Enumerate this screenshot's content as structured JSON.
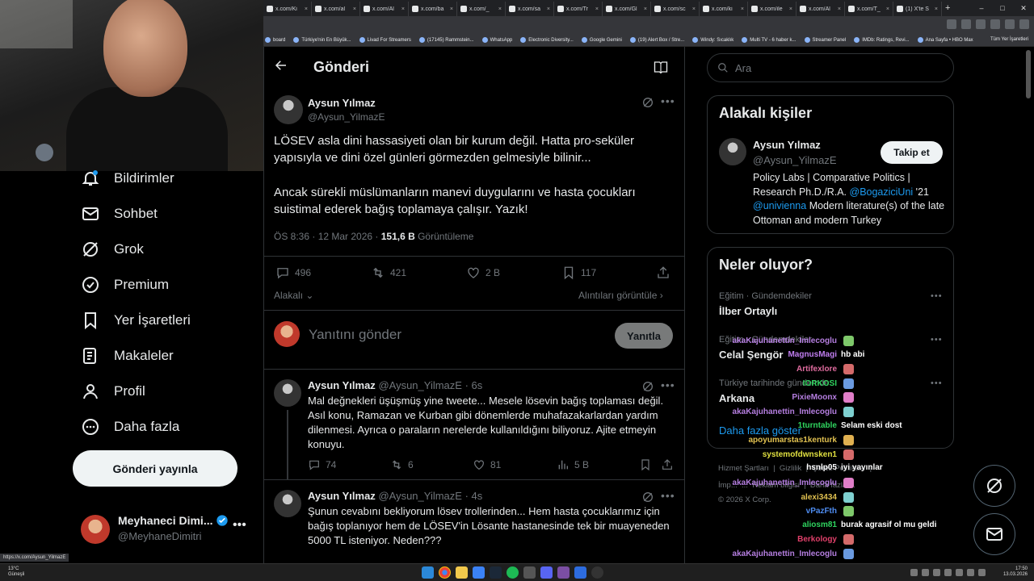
{
  "browser": {
    "tabs": [
      "x.com/Ki",
      "x.com/al",
      "x.com/Al",
      "x.com/ba",
      "x.com/_",
      "x.com/sa",
      "x.com/Tr",
      "x.com/Gl",
      "x.com/sc",
      "x.com/ki",
      "x.com/ile",
      "x.com/Al",
      "x.com/T_",
      "(1) X'te S"
    ],
    "bookmarks": [
      "board",
      "Türkiye'nin En Büyük...",
      "Livad For Streamers",
      "(17145) Rammstein...",
      "WhatsApp",
      "Electronic Diversity...",
      "Google Gemini",
      "(19) Alert Box / Stre...",
      "Windy: Sıcaklık",
      "Multi TV - 6 haber k...",
      "Streamer Panel",
      "IMDb: Ratings, Revi...",
      "Ana Sayfa • HBO Max"
    ],
    "bookmarks_all": "Tüm Yer İşaretleri",
    "status_url": "https://x.com/Aysun_YilmazE"
  },
  "nav": {
    "items": [
      {
        "label": "Bildirimler",
        "icon": "bell-icon"
      },
      {
        "label": "Sohbet",
        "icon": "mail-icon"
      },
      {
        "label": "Grok",
        "icon": "grok-icon"
      },
      {
        "label": "Premium",
        "icon": "verified-icon"
      },
      {
        "label": "Yer İşaretleri",
        "icon": "bookmark-icon"
      },
      {
        "label": "Makaleler",
        "icon": "article-icon"
      },
      {
        "label": "Profil",
        "icon": "person-icon"
      },
      {
        "label": "Daha fazla",
        "icon": "more-circle-icon"
      }
    ],
    "post_button": "Gönderi yayınla",
    "account": {
      "name": "Meyhaneci Dimi...",
      "handle": "@MeyhaneDimitri"
    }
  },
  "post": {
    "header_title": "Gönderi",
    "author_name": "Aysun Yılmaz",
    "author_handle": "@Aysun_YilmazE",
    "paragraph1": "LÖSEV asla dini hassasiyeti olan bir kurum değil. Hatta pro-seküler yapısıyla ve dini özel günleri görmezden gelmesiyle bilinir...",
    "paragraph2": "Ancak sürekli müslümanların manevi duygularını ve hasta çocukları suistimal ederek bağış toplamaya çalışır. Yazık!",
    "time": "ÖS 8:36 · 12 Mar 2026 · ",
    "views": "151,6 B",
    "views_label": " Görüntüleme",
    "stats": {
      "replies": "496",
      "reposts": "421",
      "likes": "2 B",
      "bookmarks": "117"
    },
    "relevance": "Alakalı",
    "quotes_link": "Alıntıları görüntüle",
    "reply_placeholder": "Yanıtını gönder",
    "reply_button": "Yanıtla"
  },
  "replies": [
    {
      "name": "Aysun Yılmaz",
      "handle": "@Aysun_YilmazE · 6s",
      "text": "Mal değnekleri üşüşmüş yine tweete... Mesele lösevin bağış toplaması değil. Asıl konu, Ramazan ve Kurban gibi dönemlerde muhafazakarlardan yardım dilenmesi. Ayrıca o paraların nerelerde kullanıldığını biliyoruz. Ajite etmeyin konuyu.",
      "replies": "74",
      "reposts": "6",
      "likes": "81",
      "views": "5 B"
    },
    {
      "name": "Aysun Yılmaz",
      "handle": "@Aysun_YilmazE · 4s",
      "text": "Şunun cevabını bekliyorum lösev trollerinden... Hem hasta çocuklarımız için bağış toplanıyor hem de LÖSEV'in Lösante hastanesinde tek bir muayeneden 5000 TL isteniyor. Neden???"
    }
  ],
  "right": {
    "search_placeholder": "Ara",
    "related_title": "Alakalı kişiler",
    "related": {
      "name": "Aysun Yılmaz",
      "handle": "@Aysun_YilmazE",
      "follow": "Takip et",
      "bio_1": "Policy Labs | Comparative Politics | Research Ph.D./R.A. ",
      "bio_mention1": "@BogaziciUni",
      "bio_2": " '21 ",
      "bio_mention2": "@univienna",
      "bio_3": " Modern literature(s) of the late Ottoman and modern Turkey"
    },
    "trends_title": "Neler oluyor?",
    "trends": [
      {
        "meta": "Eğitim · Gündemdekiler",
        "title": "İlber Ortaylı"
      },
      {
        "meta": "Eğitim · Gündemdekiler",
        "title": "Celal Şengör"
      },
      {
        "meta": "Türkiye tarihinde gündemde",
        "title": "Arkana"
      }
    ],
    "show_more": "Daha fazla göster",
    "footer1": "Hizmet Şartları  |  Gizlilik  |  Çerez Politikası  |",
    "footer2": "İmp...  ...  Reklam bilgisi  |  Daha fazla ...",
    "copyright": "© 2026 X Corp."
  },
  "chat": [
    {
      "user": "akaKajuhanettin_Imlecoglu",
      "msg": "",
      "color": "#b57ee0"
    },
    {
      "user": "MagnusMagi",
      "msg": "hb abi",
      "color": "#c07ef0"
    },
    {
      "user": "Artifexlore",
      "msg": "",
      "color": "#e06c9f"
    },
    {
      "user": "IORKOSI",
      "msg": "",
      "color": "#2fd45f"
    },
    {
      "user": "PixieMoonx",
      "msg": "",
      "color": "#b57ee0"
    },
    {
      "user": "akaKajuhanettin_Imlecoglu",
      "msg": "",
      "color": "#b57ee0"
    },
    {
      "user": "1turntable",
      "msg": "Selam eski dost",
      "color": "#2fd45f"
    },
    {
      "user": "apoyumarstas1kenturk",
      "msg": "",
      "color": "#e0c050"
    },
    {
      "user": "systemofdwnsken1",
      "msg": "",
      "color": "#e0e040"
    },
    {
      "user": "hsnlp05",
      "msg": "iyi yayınlar",
      "color": "#ffffff"
    },
    {
      "user": "akaKajuhanettin_Imlecoglu",
      "msg": "",
      "color": "#b57ee0"
    },
    {
      "user": "alexi3434",
      "msg": "",
      "color": "#e0c050"
    },
    {
      "user": "vPazFth",
      "msg": "",
      "color": "#4e8cf0"
    },
    {
      "user": "aliosm81",
      "msg": "burak agrasif ol mu geldi",
      "color": "#2fd45f"
    },
    {
      "user": "Berkology",
      "msg": "",
      "color": "#e0406a"
    },
    {
      "user": "akaKajuhanettin_Imlecoglu",
      "msg": "",
      "color": "#b57ee0"
    }
  ],
  "taskbar": {
    "temp": "13°C",
    "weather": "Güneşli",
    "time": "17:50",
    "date": "13.03.2026"
  }
}
